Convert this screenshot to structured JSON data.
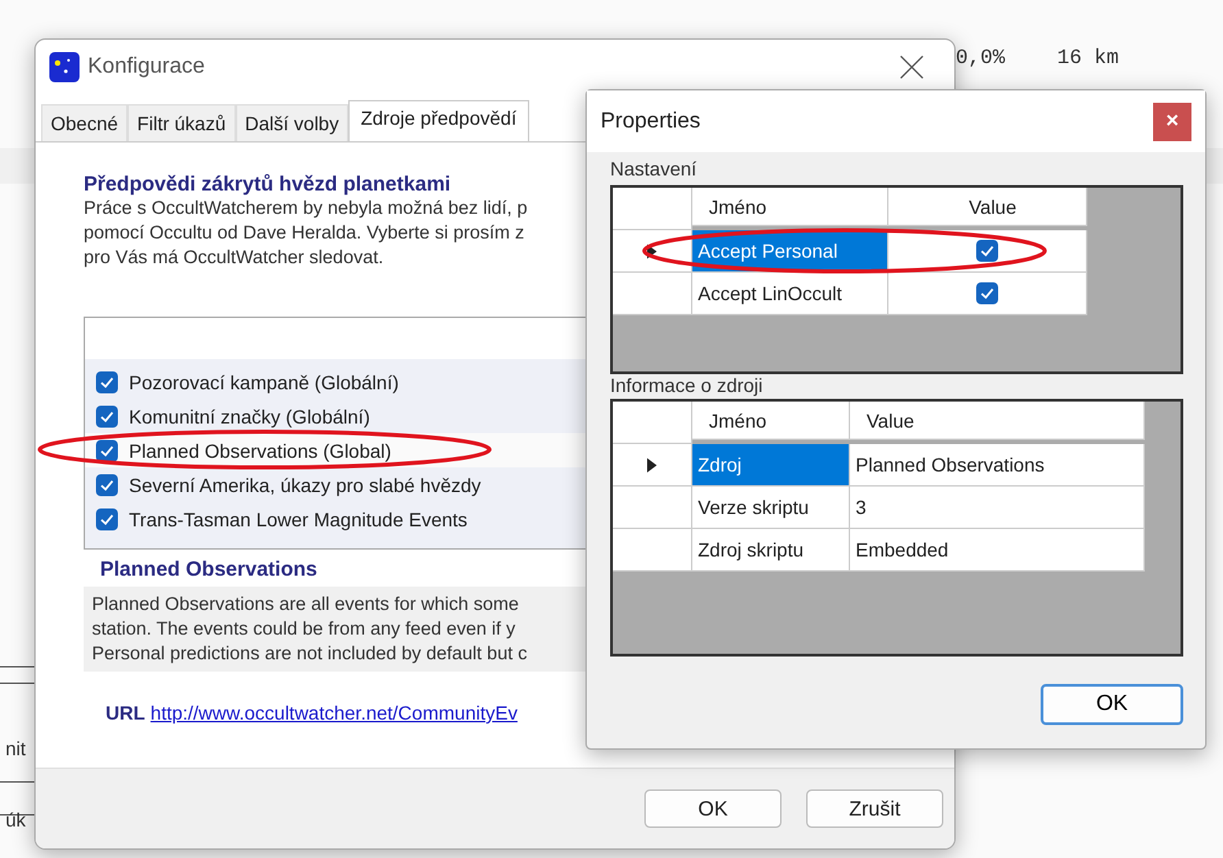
{
  "background": {
    "second_row": [
      "0,0%",
      "16 km"
    ],
    "left_fragments": [
      "nit",
      "úk"
    ]
  },
  "config_dialog": {
    "title": "Konfigurace",
    "tabs": [
      {
        "label": "Obecné",
        "selected": false
      },
      {
        "label": "Filtr úkazů",
        "selected": false
      },
      {
        "label": "Další volby",
        "selected": false
      },
      {
        "label": "Zdroje předpovědí",
        "selected": true
      }
    ],
    "heading": "Předpovědi zákrytů hvězd planetkami",
    "intro_lines": [
      "Práce s OccultWatcherem by nebyla možná bez lidí, p",
      "pomocí Occultu od Dave Heralda. Vyberte si prosím z",
      "pro Vás má OccultWatcher sledovat."
    ],
    "sources": [
      {
        "label": "Pozorovací kampaně (Globální)",
        "checked": true,
        "selected": false
      },
      {
        "label": "Komunitní značky (Globální)",
        "checked": true,
        "selected": false
      },
      {
        "label": "Planned Observations (Global)",
        "checked": true,
        "selected": true
      },
      {
        "label": "Severní Amerika, úkazy pro slabé hvězdy",
        "checked": true,
        "selected": false
      },
      {
        "label": "Trans-Tasman Lower Magnitude Events",
        "checked": true,
        "selected": false
      }
    ],
    "details": {
      "title": "Planned Observations",
      "description_lines": [
        "Planned Observations are all events for which some",
        "station. The events could be from any feed even if y",
        "Personal predictions are not included by default but c"
      ]
    },
    "url_label": "URL",
    "url": "http://www.occultwatcher.net/CommunityEv",
    "buttons": [
      "OK",
      "Zrušit"
    ]
  },
  "properties_dialog": {
    "title": "Properties",
    "close": "×",
    "settings": {
      "label": "Nastavení",
      "columns": [
        "Jméno",
        "Value"
      ],
      "rows": [
        {
          "name": "Accept Personal",
          "checked": true,
          "selected": true
        },
        {
          "name": "Accept LinOccult",
          "checked": true,
          "selected": false
        }
      ]
    },
    "info": {
      "label": "Informace o zdroji",
      "columns": [
        "Jméno",
        "Value"
      ],
      "rows": [
        {
          "name": "Zdroj",
          "value": "Planned Observations",
          "selected": true
        },
        {
          "name": "Verze skriptu",
          "value": "3",
          "selected": false
        },
        {
          "name": "Zdroj skriptu",
          "value": "Embedded",
          "selected": false
        }
      ]
    },
    "button": "OK"
  }
}
